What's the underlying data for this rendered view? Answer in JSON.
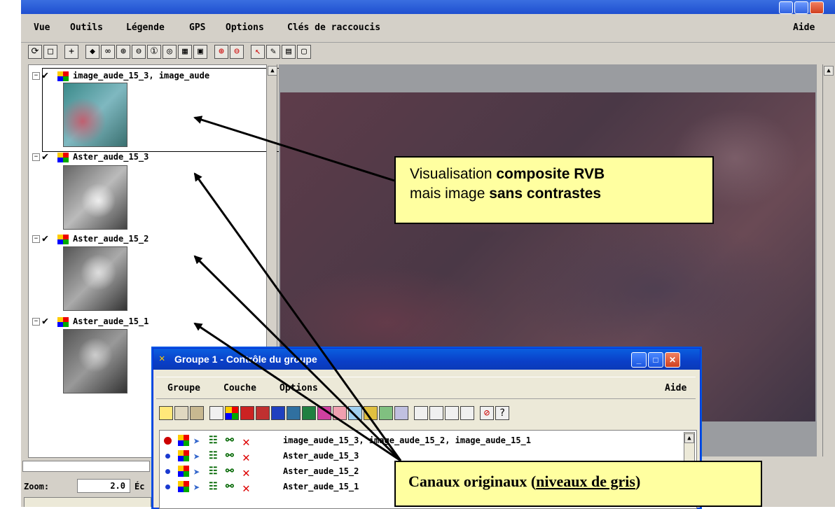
{
  "main": {
    "menu": [
      "Vue",
      "Outils",
      "Légende",
      "GPS",
      "Options",
      "Clés de raccoucis"
    ],
    "help": "Aide",
    "zoom_label": "Zoom:",
    "zoom_value": "2.0",
    "echelle_label": "Éc"
  },
  "layers": [
    {
      "name": "image_aude_15_3, image_aude"
    },
    {
      "name": "Aster_aude_15_3"
    },
    {
      "name": "Aster_aude_15_2"
    },
    {
      "name": "Aster_aude_15_1"
    }
  ],
  "dialog": {
    "title": "Groupe 1 - Contrôle du groupe",
    "menu": [
      "Groupe",
      "Couche",
      "Options"
    ],
    "help": "Aide",
    "rows": [
      {
        "name": "image_aude_15_3, image_aude_15_2, image_aude_15_1",
        "dot": "#cc0000"
      },
      {
        "name": "Aster_aude_15_3",
        "dot": "#1a3ad0"
      },
      {
        "name": "Aster_aude_15_2",
        "dot": "#1a3ad0"
      },
      {
        "name": "Aster_aude_15_1",
        "dot": "#1a3ad0"
      }
    ]
  },
  "callout1": {
    "line1_pre": "Visualisation ",
    "line1_bold": "composite RVB",
    "line2_pre": "mais image ",
    "line2_bold": "sans contrastes"
  },
  "callout2": {
    "pre": "Canaux originaux (",
    "underlined": "niveaux de gris",
    "post": ")"
  }
}
